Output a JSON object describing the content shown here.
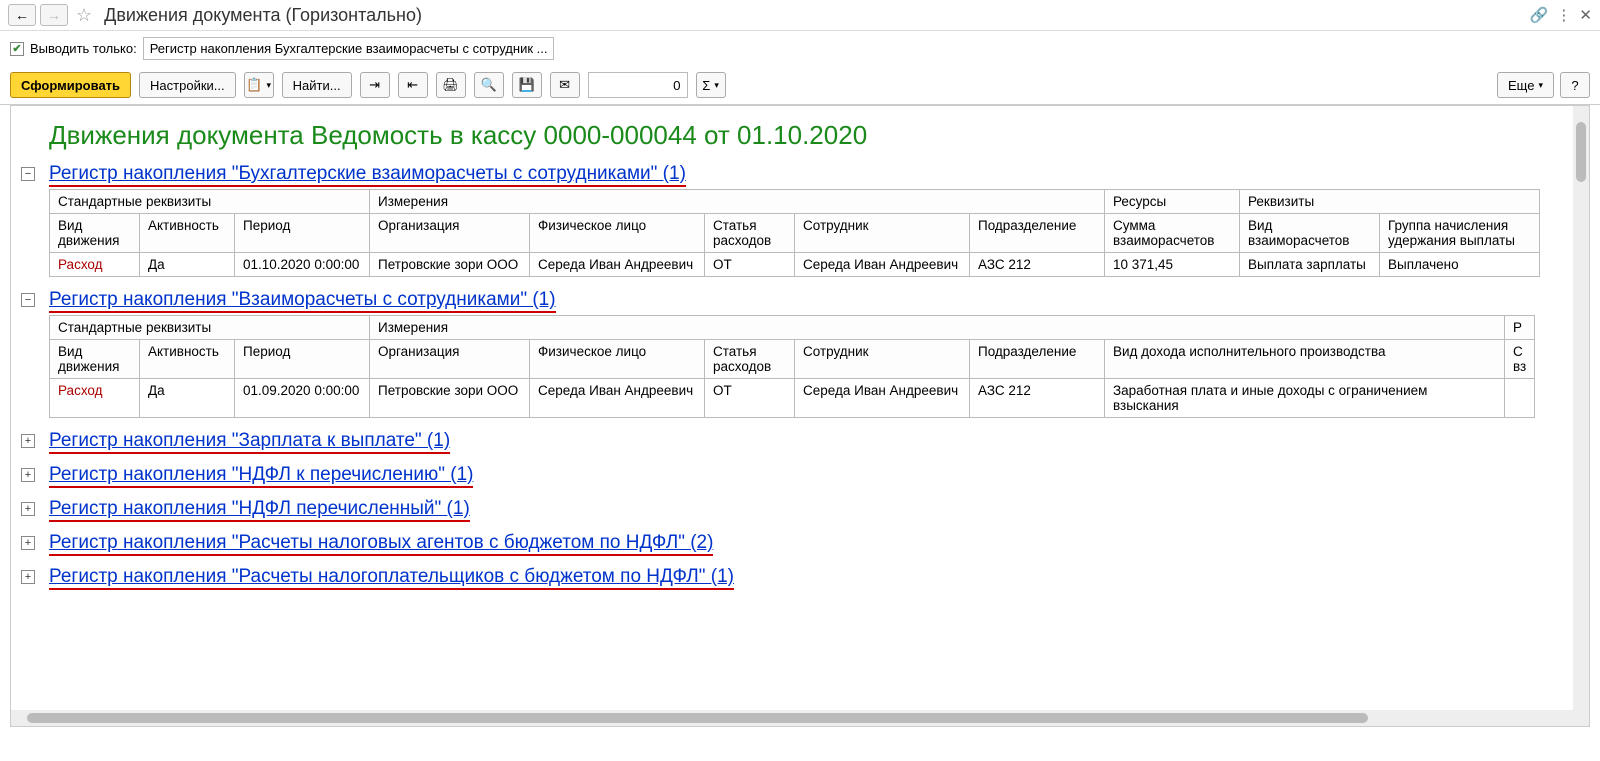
{
  "titlebar": {
    "title": "Движения документа (Горизонтально)"
  },
  "filter": {
    "checkbox_checked": true,
    "label": "Выводить только:",
    "select_text": "Регистр накопления Бухгалтерские взаиморасчеты с сотрудник ..."
  },
  "toolbar": {
    "form_btn": "Сформировать",
    "settings_btn": "Настройки...",
    "find_btn": "Найти...",
    "num_value": "0",
    "more_btn": "Еще",
    "help_btn": "?"
  },
  "report": {
    "title": "Движения документа Ведомость в кассу 0000-000044 от 01.10.2020",
    "reg1": {
      "link": "Регистр накопления \"Бухгалтерские взаиморасчеты с сотрудниками\" (1)",
      "groups": {
        "std": "Стандартные реквизиты",
        "dim": "Измерения",
        "res": "Ресурсы",
        "req": "Реквизиты"
      },
      "cols": [
        "Вид движения",
        "Активность",
        "Период",
        "Организация",
        "Физическое лицо",
        "Статья расходов",
        "Сотрудник",
        "Подразделение",
        "Сумма взаиморасчетов",
        "Вид взаиморасчетов",
        "Группа начисления удержания выплаты"
      ],
      "row": [
        "Расход",
        "Да",
        "01.10.2020 0:00:00",
        "Петровские зори ООО",
        "Середа Иван Андреевич",
        "ОТ",
        "Середа Иван Андреевич",
        "АЗС 212",
        "10 371,45",
        "Выплата зарплаты",
        "Выплачено"
      ]
    },
    "reg2": {
      "link": "Регистр накопления \"Взаиморасчеты с сотрудниками\" (1)",
      "groups": {
        "std": "Стандартные реквизиты",
        "dim": "Измерения",
        "res_short": "Р",
        "res2": "С вз"
      },
      "cols": [
        "Вид движения",
        "Активность",
        "Период",
        "Организация",
        "Физическое лицо",
        "Статья расходов",
        "Сотрудник",
        "Подразделение",
        "Вид дохода исполнительного производства"
      ],
      "row": [
        "Расход",
        "Да",
        "01.09.2020 0:00:00",
        "Петровские зори ООО",
        "Середа Иван Андреевич",
        "ОТ",
        "Середа Иван Андреевич",
        "АЗС 212",
        "Заработная плата и иные доходы с ограничением взыскания"
      ]
    },
    "collapsed": [
      "Регистр накопления \"Зарплата к выплате\" (1)",
      "Регистр накопления \"НДФЛ к перечислению\" (1)",
      "Регистр накопления \"НДФЛ перечисленный\" (1)",
      "Регистр накопления \"Расчеты налоговых агентов с бюджетом по НДФЛ\" (2)",
      "Регистр накопления \"Расчеты налогоплательщиков с бюджетом по НДФЛ\" (1)"
    ]
  }
}
